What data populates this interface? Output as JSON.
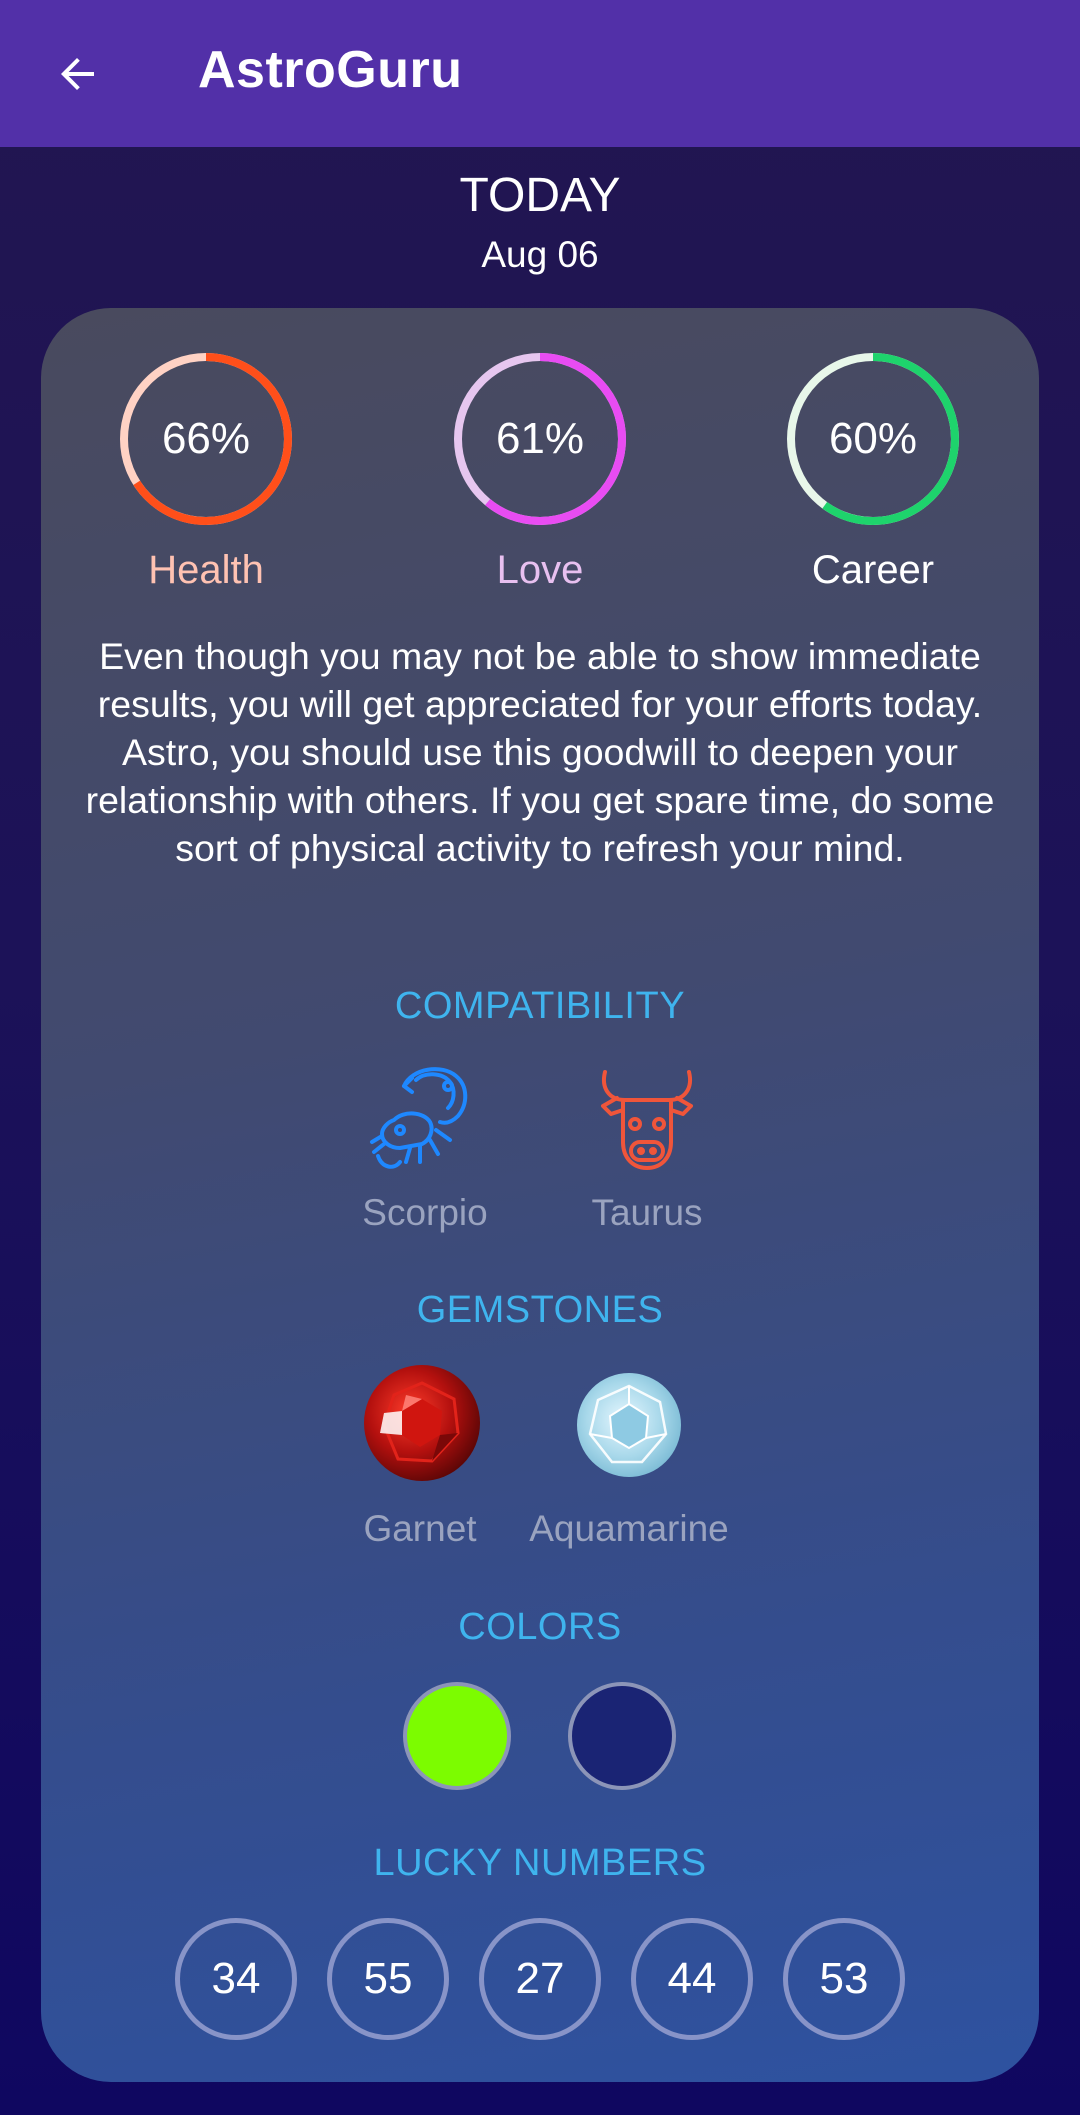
{
  "appbar": {
    "title": "AstroGuru",
    "back_icon": "arrow-back-icon"
  },
  "header": {
    "today": "TODAY",
    "date": "Aug 06"
  },
  "meters": [
    {
      "label": "Health",
      "percent_text": "66%",
      "value": 66,
      "color": "#ff4f1a",
      "track": "#ffd2c4",
      "label_color": "#ffc2b2"
    },
    {
      "label": "Love",
      "percent_text": "61%",
      "value": 61,
      "color": "#e84cf2",
      "track": "#e6c6ef",
      "label_color": "#e8c0f0"
    },
    {
      "label": "Career",
      "percent_text": "60%",
      "value": 60,
      "color": "#1ed36c",
      "track": "#e8f7ea",
      "label_color": "#ffffff"
    }
  ],
  "horoscope": "Even though you may not be able to show immediate results, you will get appreciated for your efforts today. Astro, you should use this goodwill to deepen your relationship with others. If you get spare time, do some sort of physical activity to refresh your mind.",
  "compatibility": {
    "title": "COMPATIBILITY",
    "signs": [
      {
        "name": "Scorpio",
        "icon": "scorpio-icon",
        "color": "#1e88ff"
      },
      {
        "name": "Taurus",
        "icon": "taurus-icon",
        "color": "#f0553a"
      }
    ]
  },
  "gemstones": {
    "title": "GEMSTONES",
    "items": [
      {
        "name": "Garnet",
        "icon": "garnet-gem-icon",
        "color": "#b3100e"
      },
      {
        "name": "Aquamarine",
        "icon": "aquamarine-gem-icon",
        "color": "#a8d8ea"
      }
    ]
  },
  "colors": {
    "title": "COLORS",
    "swatches": [
      "#7cfc00",
      "#1a2474"
    ]
  },
  "lucky_numbers": {
    "title": "LUCKY NUMBERS",
    "numbers": [
      "34",
      "55",
      "27",
      "44",
      "53"
    ]
  }
}
